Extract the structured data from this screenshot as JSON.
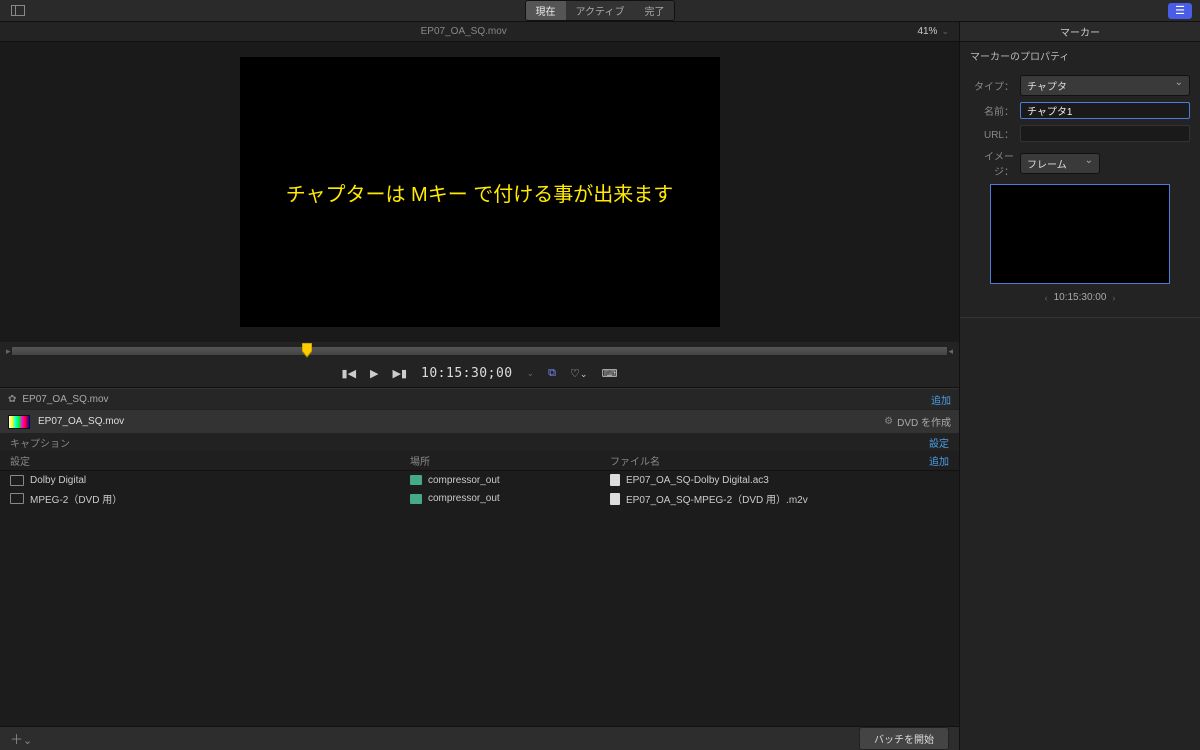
{
  "toolbar": {
    "tabs": {
      "current": "現在",
      "active": "アクティブ",
      "done": "完了"
    }
  },
  "preview": {
    "filename": "EP07_OA_SQ.mov",
    "zoom": "41%",
    "subtitle": "チャプターは Mキー で付ける事が出来ます",
    "timecode": "10:15:30;00"
  },
  "batch": {
    "header_title": "EP07_OA_SQ.mov",
    "add": "追加",
    "job_name": "EP07_OA_SQ.mov",
    "job_action": "DVD を作成",
    "caption_label": "キャプション",
    "caption_action": "設定",
    "columns": {
      "setting": "設定",
      "location": "場所",
      "filename": "ファイル名",
      "add": "追加"
    },
    "rows": [
      {
        "setting": "Dolby Digital",
        "location": "compressor_out",
        "filename": "EP07_OA_SQ-Dolby Digital.ac3"
      },
      {
        "setting": "MPEG-2（DVD 用）",
        "location": "compressor_out",
        "filename": "EP07_OA_SQ-MPEG-2（DVD 用）.m2v"
      }
    ]
  },
  "footer": {
    "start": "バッチを開始"
  },
  "inspector": {
    "title": "マーカー",
    "props_heading": "マーカーのプロパティ",
    "type_label": "タイプ：",
    "type_value": "チャプタ",
    "name_label": "名前：",
    "name_value": "チャプタ1",
    "url_label": "URL：",
    "url_value": "",
    "image_label": "イメージ：",
    "image_value": "フレーム",
    "timecode": "10:15:30:00"
  }
}
